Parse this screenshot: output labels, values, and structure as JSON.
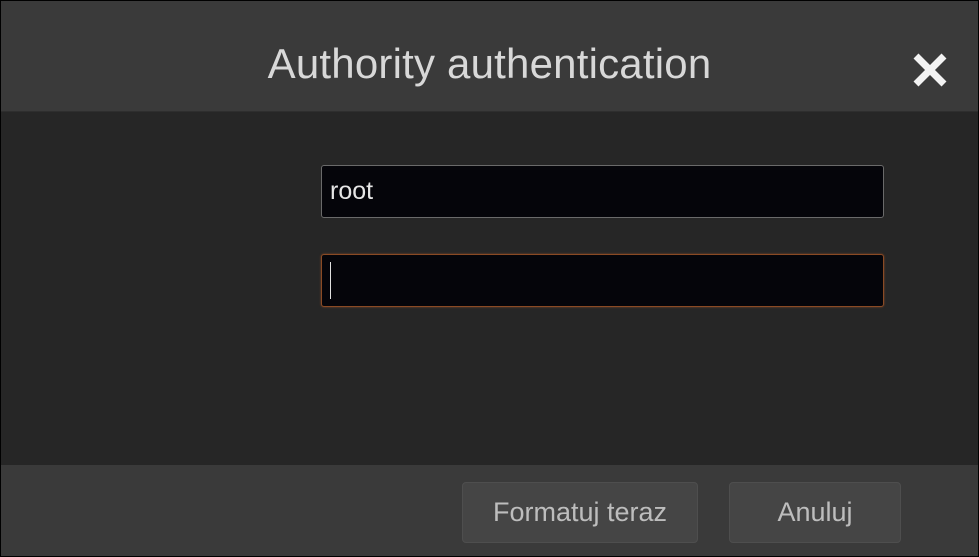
{
  "dialog": {
    "title": "Authority authentication",
    "close_icon": "close-icon"
  },
  "form": {
    "username": {
      "value": "root",
      "placeholder": ""
    },
    "password": {
      "value": "",
      "placeholder": "",
      "focused": true
    }
  },
  "buttons": {
    "format_label": "Formatuj teraz",
    "cancel_label": "Anuluj"
  },
  "colors": {
    "titlebar_bg": "#3a3a3a",
    "body_bg": "#262626",
    "input_bg": "#05050a",
    "focus_border": "#8a4a24",
    "text": "#d8d8d8"
  }
}
